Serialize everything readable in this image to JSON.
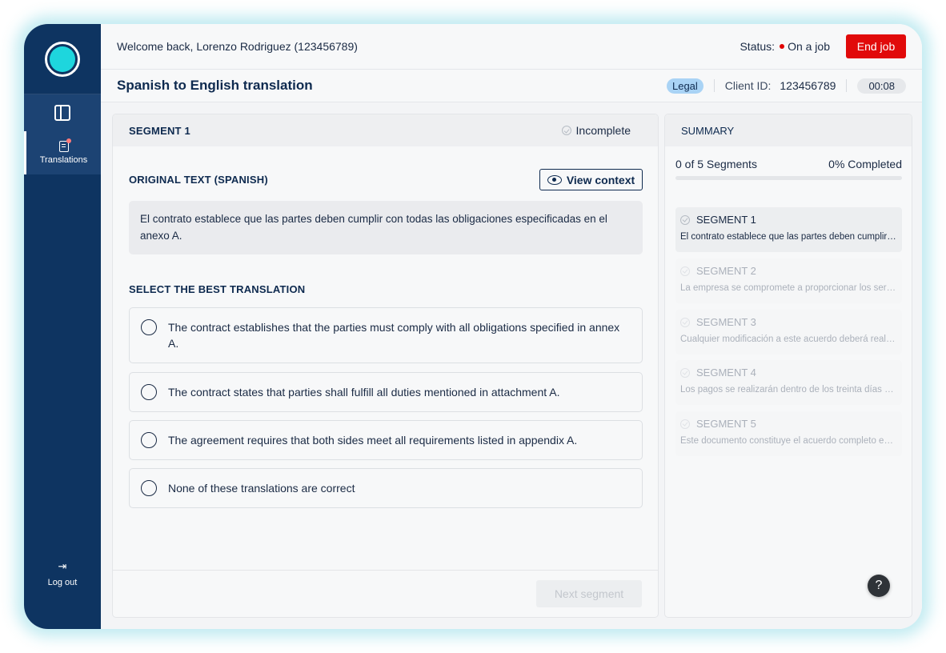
{
  "sidebar": {
    "nav_label": "Translations",
    "logout_label": "Log out"
  },
  "header": {
    "welcome": "Welcome back,  Lorenzo Rodriguez (123456789)",
    "status_label": "Status:",
    "status_value": "On a job",
    "end_job": "End job"
  },
  "job": {
    "title": "Spanish to English translation",
    "tag": "Legal",
    "client_label": "Client ID:",
    "client_id": "123456789",
    "timer": "00:08"
  },
  "segment": {
    "title": "SEGMENT 1",
    "status": "Incomplete",
    "original_label": "ORIGINAL TEXT (SPANISH)",
    "view_context": "View context",
    "original_text": "El contrato establece que las partes deben cumplir con todas las obligaciones especificadas en el anexo A.",
    "select_label": "SELECT THE BEST TRANSLATION",
    "options": [
      "The contract establishes that the parties must comply with all obligations specified in annex A.",
      "The contract states that parties shall fulfill all duties mentioned in attachment A.",
      "The agreement requires that both sides meet all requirements listed in appendix A.",
      "None of these translations are correct"
    ],
    "next": "Next segment"
  },
  "summary": {
    "title": "SUMMARY",
    "progress_text": "0 of 5 Segments",
    "percent_text": "0% Completed",
    "progress_fraction": 0,
    "items": [
      {
        "title": "SEGMENT 1",
        "text": "El contrato establece que las partes deben cumplir con todas las obligaciones"
      },
      {
        "title": "SEGMENT 2",
        "text": "La empresa se compromete a proporcionar los servicios acordados"
      },
      {
        "title": "SEGMENT 3",
        "text": "Cualquier modificación a este acuerdo deberá realizarse por escrito"
      },
      {
        "title": "SEGMENT 4",
        "text": "Los pagos se realizarán dentro de los treinta días siguientes"
      },
      {
        "title": "SEGMENT 5",
        "text": "Este documento constituye el acuerdo completo entre las partes"
      }
    ]
  },
  "help": "?"
}
